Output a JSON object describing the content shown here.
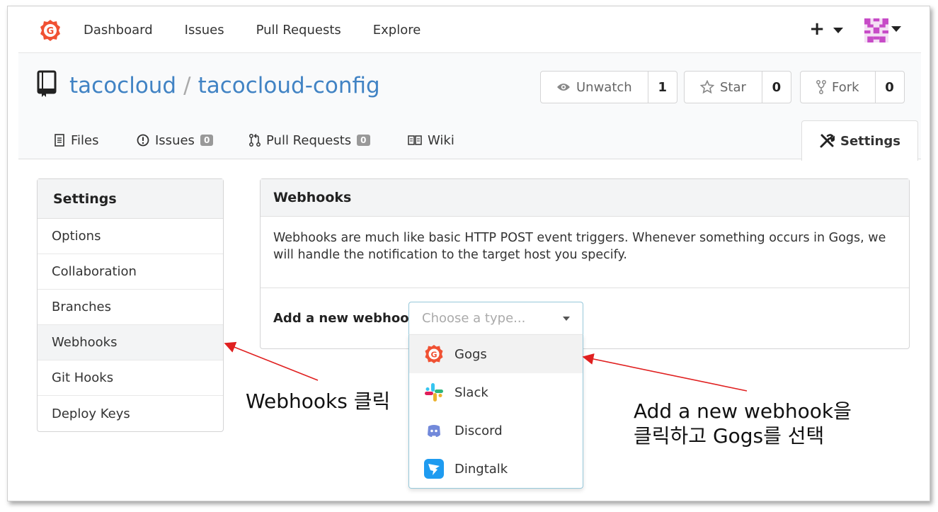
{
  "nav": {
    "items": [
      {
        "label": "Dashboard"
      },
      {
        "label": "Issues"
      },
      {
        "label": "Pull Requests"
      },
      {
        "label": "Explore"
      }
    ],
    "plus": "+"
  },
  "repo": {
    "owner": "tacocloud",
    "separator": "/",
    "name": "tacocloud-config",
    "unwatch_label": "Unwatch",
    "unwatch_count": "1",
    "star_label": "Star",
    "star_count": "0",
    "fork_label": "Fork",
    "fork_count": "0"
  },
  "tabs": {
    "files": "Files",
    "issues": "Issues",
    "issues_count": "0",
    "pulls": "Pull Requests",
    "pulls_count": "0",
    "wiki": "Wiki",
    "settings": "Settings"
  },
  "sidebar": {
    "title": "Settings",
    "items": [
      {
        "label": "Options"
      },
      {
        "label": "Collaboration"
      },
      {
        "label": "Branches"
      },
      {
        "label": "Webhooks"
      },
      {
        "label": "Git Hooks"
      },
      {
        "label": "Deploy Keys"
      }
    ],
    "active": "Webhooks"
  },
  "webhooks": {
    "title": "Webhooks",
    "description": "Webhooks are much like basic HTTP POST event triggers. Whenever something occurs in Gogs, we will handle the notification to the target host you specify.",
    "add_label": "Add a new webhook:",
    "placeholder": "Choose a type...",
    "options": [
      {
        "label": "Gogs",
        "icon": "gogs-icon"
      },
      {
        "label": "Slack",
        "icon": "slack-icon"
      },
      {
        "label": "Discord",
        "icon": "discord-icon"
      },
      {
        "label": "Dingtalk",
        "icon": "dingtalk-icon"
      }
    ]
  },
  "annotations": {
    "note1": "Webhooks 클릭",
    "note2_line1": "Add a new webhook을",
    "note2_line2": "클릭하고 Gogs를 선택",
    "arrow_color": "#e02020"
  },
  "colors": {
    "link": "#4183c4",
    "gogs": "#f05133"
  }
}
